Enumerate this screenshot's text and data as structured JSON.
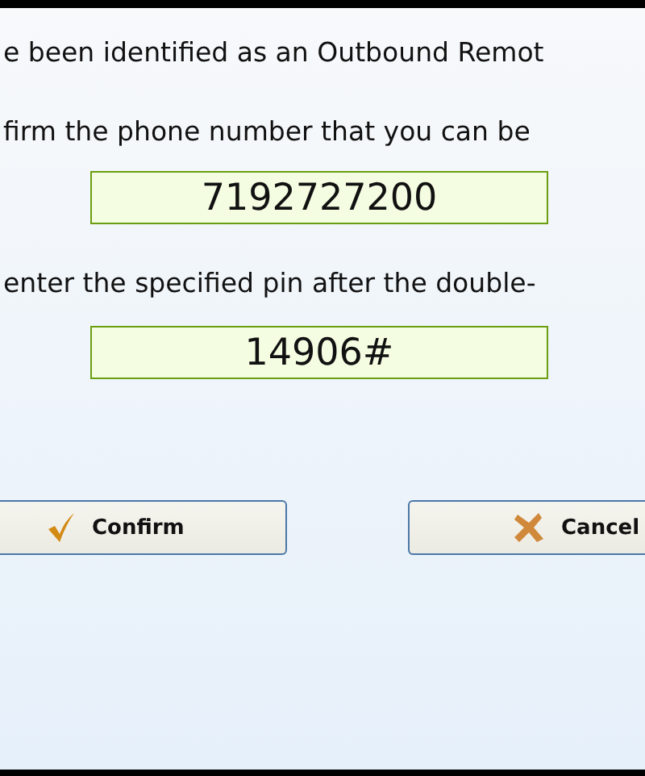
{
  "lines": [
    "e been identified as an Outbound Remot",
    "firm the phone number that you can be"
  ],
  "phone_field": {
    "value": "7192727200"
  },
  "pin_line": "enter the specified pin after the double-",
  "pin_field": {
    "value": "14906#"
  },
  "buttons": [
    {
      "kind": "confirm",
      "label": "Confirm"
    },
    {
      "kind": "cancel",
      "label": "Cancel"
    }
  ]
}
